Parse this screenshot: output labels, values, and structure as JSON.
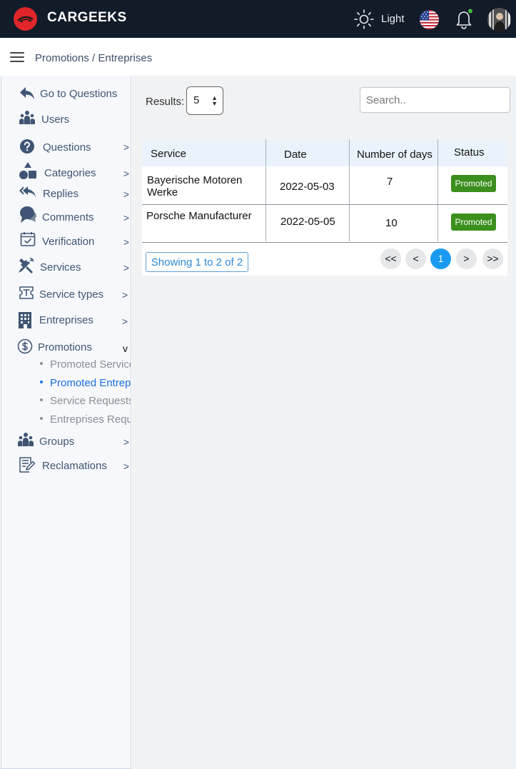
{
  "header": {
    "brand": "CARGEEKS",
    "theme_label": "Light",
    "icons": [
      "logo-icon",
      "sun-icon",
      "us-flag-icon",
      "bell-icon",
      "avatar"
    ],
    "colors": {
      "topbar": "#121b28",
      "logo": "#e0262a",
      "accent": "#1a9af0",
      "badge": "#3b8f1d"
    }
  },
  "breadcrumb": "Promotions / Entreprises",
  "sidebar": {
    "items": [
      {
        "label": "Go to Questions",
        "arrow": ""
      },
      {
        "label": "Users",
        "arrow": ""
      },
      {
        "label": "Questions",
        "arrow": ">"
      },
      {
        "label": "Categories",
        "arrow": ">"
      },
      {
        "label": "Replies",
        "arrow": ">"
      },
      {
        "label": "Comments",
        "arrow": ">"
      },
      {
        "label": "Verification",
        "arrow": ">"
      },
      {
        "label": "Services",
        "arrow": ">"
      },
      {
        "label": "Service types",
        "arrow": ">"
      },
      {
        "label": "Entreprises",
        "arrow": ">"
      },
      {
        "label": "Promotions",
        "arrow": "v"
      },
      {
        "label": "Groups",
        "arrow": ">"
      },
      {
        "label": "Reclamations",
        "arrow": ">"
      }
    ],
    "promotions_sub": [
      {
        "label": "Promoted Services"
      },
      {
        "label": "Promoted Entreprises"
      },
      {
        "label": "Service Requests"
      },
      {
        "label": "Entreprises Requests"
      }
    ]
  },
  "main": {
    "results_label": "Results:",
    "results_value": "5",
    "search_placeholder": "Search..",
    "table": {
      "headers": [
        "Service",
        "Date",
        "Number of days",
        "Status"
      ],
      "rows": [
        {
          "service": "Bayerische Motoren Werke",
          "date": "2022-05-03",
          "days": "7",
          "status": "Promoted"
        },
        {
          "service": "Porsche Manufacturer",
          "date": "2022-05-05",
          "days": "10",
          "status": "Promoted"
        }
      ]
    },
    "showing": "Showing 1 to 2 of 2",
    "pagination": [
      "<<",
      "<",
      "1",
      ">",
      ">>"
    ]
  }
}
